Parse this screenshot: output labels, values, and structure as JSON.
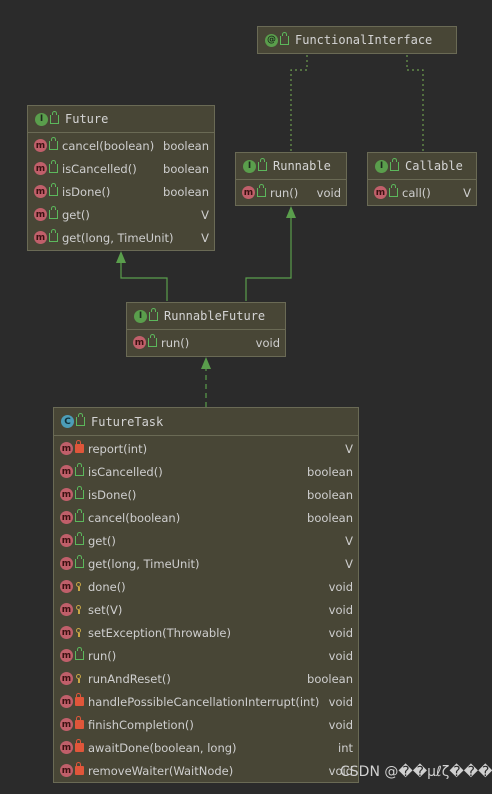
{
  "nodes": {
    "functional_interface": {
      "title": "FunctionalInterface",
      "kind": "annotation"
    },
    "future": {
      "title": "Future",
      "kind": "interface",
      "methods": [
        {
          "name": "cancel(boolean)",
          "type": "boolean"
        },
        {
          "name": "isCancelled()",
          "type": "boolean"
        },
        {
          "name": "isDone()",
          "type": "boolean"
        },
        {
          "name": "get()",
          "type": "V"
        },
        {
          "name": "get(long, TimeUnit)",
          "type": "V"
        }
      ]
    },
    "runnable": {
      "title": "Runnable",
      "kind": "interface",
      "methods": [
        {
          "name": "run()",
          "type": "void"
        }
      ]
    },
    "callable": {
      "title": "Callable",
      "kind": "interface",
      "methods": [
        {
          "name": "call()",
          "type": "V"
        }
      ]
    },
    "runnable_future": {
      "title": "RunnableFuture",
      "kind": "interface",
      "methods": [
        {
          "name": "run()",
          "type": "void"
        }
      ]
    },
    "future_task": {
      "title": "FutureTask",
      "kind": "class",
      "methods": [
        {
          "name": "report(int)",
          "type": "V",
          "visibility": "private"
        },
        {
          "name": "isCancelled()",
          "type": "boolean",
          "visibility": "public"
        },
        {
          "name": "isDone()",
          "type": "boolean",
          "visibility": "public"
        },
        {
          "name": "cancel(boolean)",
          "type": "boolean",
          "visibility": "public"
        },
        {
          "name": "get()",
          "type": "V",
          "visibility": "public"
        },
        {
          "name": "get(long, TimeUnit)",
          "type": "V",
          "visibility": "public"
        },
        {
          "name": "done()",
          "type": "void",
          "visibility": "protected"
        },
        {
          "name": "set(V)",
          "type": "void",
          "visibility": "protected"
        },
        {
          "name": "setException(Throwable)",
          "type": "void",
          "visibility": "protected"
        },
        {
          "name": "run()",
          "type": "void",
          "visibility": "public"
        },
        {
          "name": "runAndReset()",
          "type": "boolean",
          "visibility": "protected"
        },
        {
          "name": "handlePossibleCancellationInterrupt(int)",
          "type": "void",
          "visibility": "private"
        },
        {
          "name": "finishCompletion()",
          "type": "void",
          "visibility": "private"
        },
        {
          "name": "awaitDone(boolean, long)",
          "type": "int",
          "visibility": "private"
        },
        {
          "name": "removeWaiter(WaitNode)",
          "type": "void",
          "visibility": "private"
        }
      ]
    }
  },
  "icons": {
    "interface": "I",
    "annotation": "@",
    "class": "C",
    "method": "m"
  },
  "colors": {
    "background": "#2b2b2b",
    "node": "#484636",
    "edge": "#5a9e4c",
    "interface_badge": "#5a9e4c",
    "class_badge": "#4c9db8",
    "method_badge": "#c05f6a"
  },
  "watermark": "CSDN @��μℓζ���→"
}
